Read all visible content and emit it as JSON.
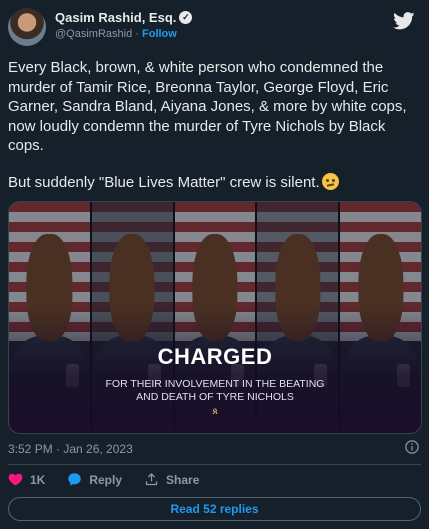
{
  "author": {
    "name": "Qasim Rashid, Esq.",
    "handle": "@QasimRashid",
    "separator": "·",
    "follow_label": "Follow"
  },
  "tweet": {
    "paragraph1": "Every Black, brown, & white person who condemned the murder of Tamir Rice, Breonna Taylor, George Floyd, Eric Garner, Sandra Bland, Aiyana Jones, & more by white cops, now loudly condemn the murder of Tyre Nichols by Black cops.",
    "paragraph2": "But suddenly \"Blue Lives Matter\" crew is silent.",
    "emoji": "thinking-face"
  },
  "media": {
    "headline": "CHARGED",
    "subline1": "FOR THEIR INVOLVEMENT IN THE BEATING",
    "subline2": "AND DEATH OF TYRE NICHOLS",
    "mark": "𝕶"
  },
  "meta": {
    "timestamp": "3:52 PM · Jan 26, 2023"
  },
  "actions": {
    "like_count": "1K",
    "reply_label": "Reply",
    "share_label": "Share"
  },
  "read_replies_label": "Read 52 replies",
  "colors": {
    "background": "#15202b",
    "accent": "#1d9bf0",
    "like": "#f91880"
  }
}
